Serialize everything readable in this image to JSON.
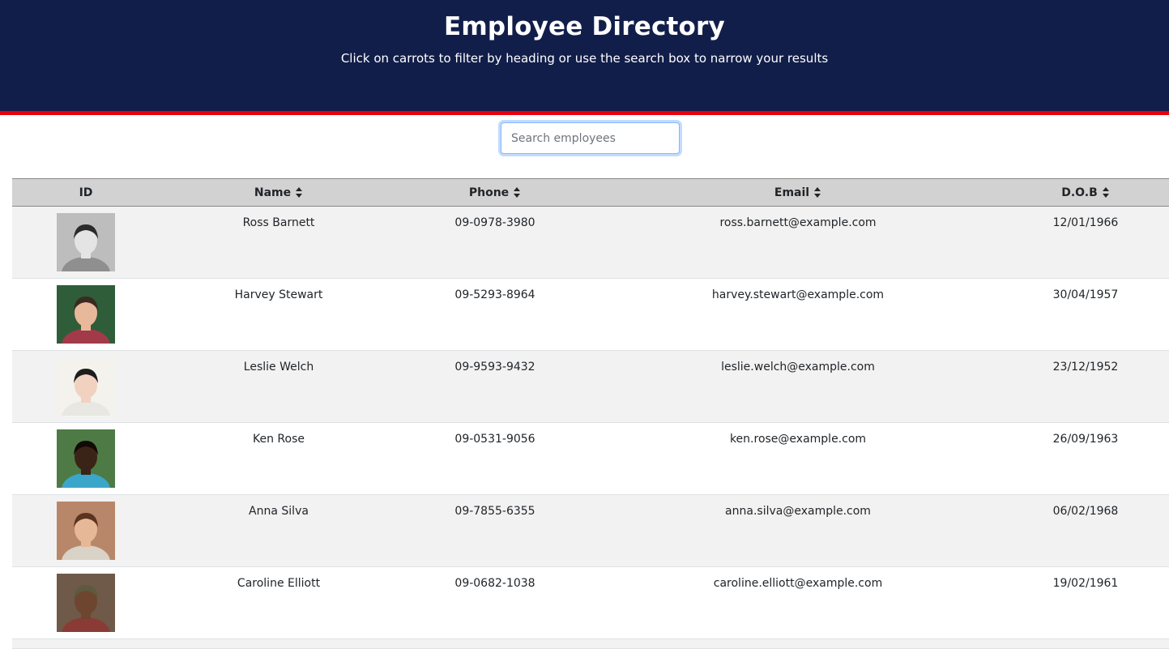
{
  "header": {
    "title": "Employee Directory",
    "subtitle": "Click on carrots to filter by heading or use the search box to narrow your results",
    "background": "#121e4a",
    "accent": "#e8000c"
  },
  "search": {
    "placeholder": "Search employees",
    "value": ""
  },
  "table": {
    "columns": [
      {
        "label": "ID",
        "sortable": false
      },
      {
        "label": "Name",
        "sortable": true,
        "icon": "sort-icon"
      },
      {
        "label": "Phone",
        "sortable": true,
        "icon": "sort-icon"
      },
      {
        "label": "Email",
        "sortable": true,
        "icon": "sort-icon"
      },
      {
        "label": "D.O.B",
        "sortable": true,
        "icon": "sort-icon"
      }
    ],
    "rows": [
      {
        "name": "Ross Barnett",
        "phone": "09-0978-3980",
        "email": "ross.barnett@example.com",
        "dob": "12/01/1966",
        "avatar": {
          "bg": "#bdbdbd",
          "skin": "#e4e4e4",
          "hair": "#2a2a2a",
          "shirt": "#8f8f8f"
        }
      },
      {
        "name": "Harvey Stewart",
        "phone": "09-5293-8964",
        "email": "harvey.stewart@example.com",
        "dob": "30/04/1957",
        "avatar": {
          "bg": "#2f5d3a",
          "skin": "#e8b89b",
          "hair": "#3a2a20",
          "shirt": "#a23a4a"
        }
      },
      {
        "name": "Leslie Welch",
        "phone": "09-9593-9432",
        "email": "leslie.welch@example.com",
        "dob": "23/12/1952",
        "avatar": {
          "bg": "#f3f2ec",
          "skin": "#f1d2c0",
          "hair": "#1c1c1c",
          "shirt": "#e8e8e2"
        }
      },
      {
        "name": "Ken Rose",
        "phone": "09-0531-9056",
        "email": "ken.rose@example.com",
        "dob": "26/09/1963",
        "avatar": {
          "bg": "#4e7a46",
          "skin": "#3a2418",
          "hair": "#120a06",
          "shirt": "#3aa6c9"
        }
      },
      {
        "name": "Anna Silva",
        "phone": "09-7855-6355",
        "email": "anna.silva@example.com",
        "dob": "06/02/1968",
        "avatar": {
          "bg": "#b8876a",
          "skin": "#e6b898",
          "hair": "#5a3420",
          "shirt": "#d9d2c6"
        }
      },
      {
        "name": "Caroline Elliott",
        "phone": "09-0682-1038",
        "email": "caroline.elliott@example.com",
        "dob": "19/02/1961",
        "avatar": {
          "bg": "#6f5a4a",
          "skin": "#6e4630",
          "hair": "#5c5a40",
          "shirt": "#8a3b36"
        }
      }
    ]
  }
}
